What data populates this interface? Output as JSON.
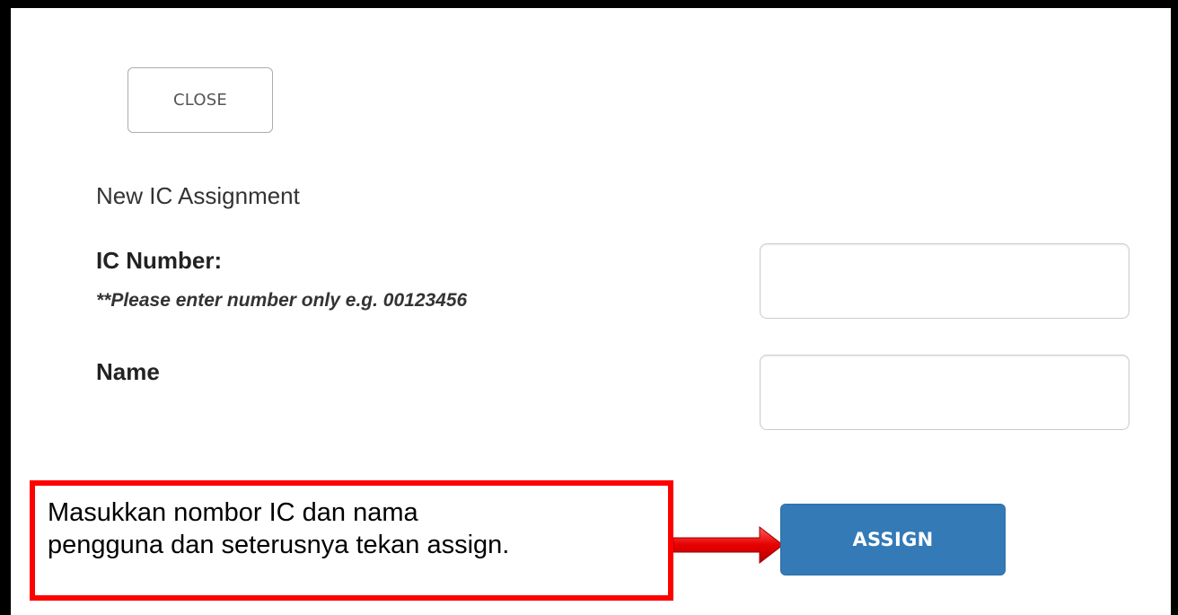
{
  "dialog": {
    "close_label": "CLOSE",
    "section_title": "New IC Assignment"
  },
  "form": {
    "ic_label": "IC Number:",
    "ic_hint": "**Please enter number only e.g. 00123456",
    "ic_value": "",
    "name_label": "Name",
    "name_value": "",
    "assign_label": "ASSIGN"
  },
  "annotation": {
    "line1": "Masukkan nombor IC dan nama",
    "line2": "pengguna dan seterusnya tekan assign."
  },
  "colors": {
    "assign_button": "#337ab7",
    "callout_border": "#ff0000",
    "arrow": "#e00000"
  }
}
